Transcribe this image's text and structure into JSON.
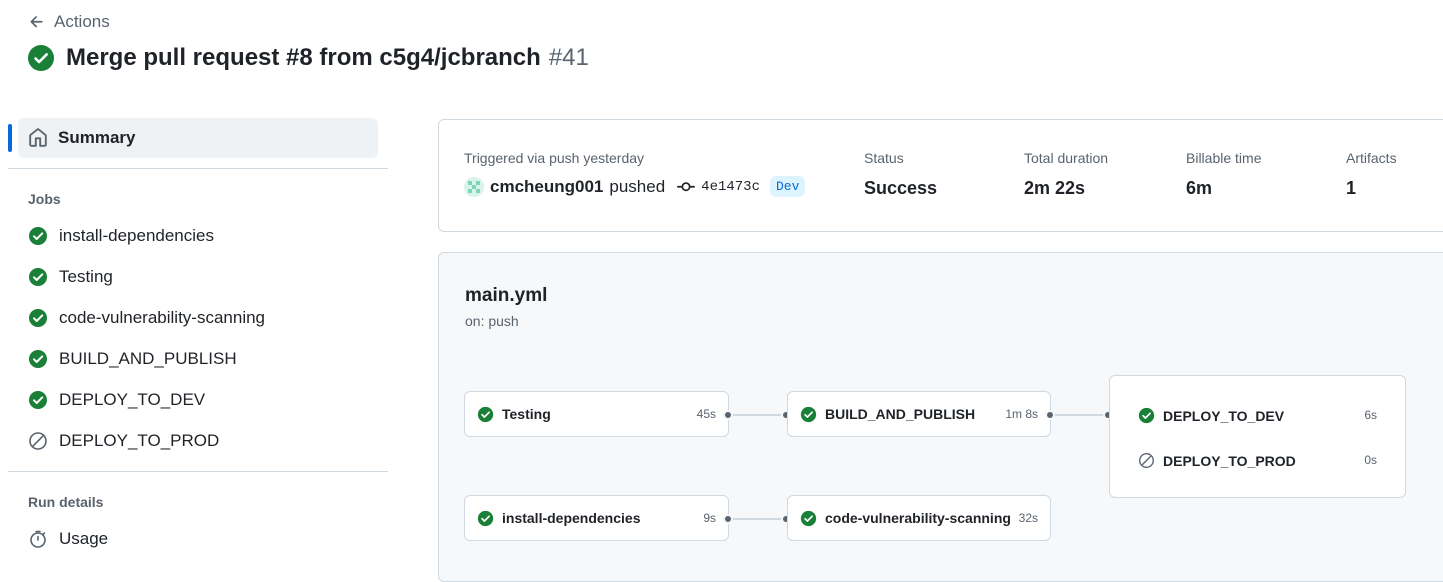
{
  "header": {
    "back_label": "Actions",
    "title": "Merge pull request #8 from c5g4/jcbranch",
    "run_number": "#41"
  },
  "sidebar": {
    "summary_label": "Summary",
    "jobs_heading": "Jobs",
    "jobs": [
      {
        "label": "install-dependencies",
        "status": "success"
      },
      {
        "label": "Testing",
        "status": "success"
      },
      {
        "label": "code-vulnerability-scanning",
        "status": "success"
      },
      {
        "label": "BUILD_AND_PUBLISH",
        "status": "success"
      },
      {
        "label": "DEPLOY_TO_DEV",
        "status": "success"
      },
      {
        "label": "DEPLOY_TO_PROD",
        "status": "skipped"
      }
    ],
    "run_details_heading": "Run details",
    "usage_label": "Usage"
  },
  "run": {
    "trigger_text": "Triggered via push yesterday",
    "actor": "cmcheung001",
    "action": "pushed",
    "commit_sha": "4e1473c",
    "branch": "Dev",
    "status_label": "Status",
    "status_value": "Success",
    "duration_label": "Total duration",
    "duration_value": "2m 22s",
    "billable_label": "Billable time",
    "billable_value": "6m",
    "artifacts_label": "Artifacts",
    "artifacts_value": "1"
  },
  "workflow": {
    "file": "main.yml",
    "trigger": "on: push",
    "jobs": {
      "testing": {
        "label": "Testing",
        "duration": "45s"
      },
      "build": {
        "label": "BUILD_AND_PUBLISH",
        "duration": "1m 8s"
      },
      "deploy_dev": {
        "label": "DEPLOY_TO_DEV",
        "duration": "6s"
      },
      "deploy_prod": {
        "label": "DEPLOY_TO_PROD",
        "duration": "0s"
      },
      "install": {
        "label": "install-dependencies",
        "duration": "9s"
      },
      "scan": {
        "label": "code-vulnerability-scanning",
        "duration": "32s"
      }
    }
  },
  "colors": {
    "success": "#1a7f37",
    "skipped": "#59636e",
    "accent": "#0969da"
  }
}
